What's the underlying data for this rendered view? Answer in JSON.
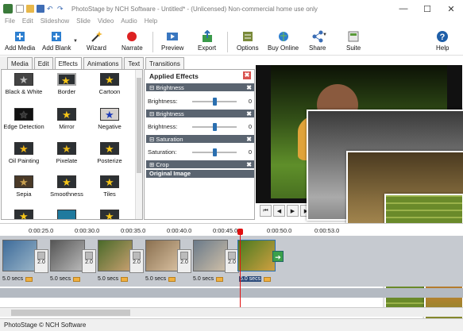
{
  "window": {
    "title": "PhotoStage by NCH Software - Untitled* - (Unlicensed) Non-commercial home use only",
    "minimize": "—",
    "maximize": "☐",
    "close": "✕"
  },
  "menu": [
    "File",
    "Edit",
    "Slideshow",
    "Slide",
    "Video",
    "Audio",
    "Help"
  ],
  "toolbar": {
    "add_media": "Add Media",
    "add_blank": "Add Blank",
    "wizard": "Wizard",
    "narrate": "Narrate",
    "preview": "Preview",
    "export": "Export",
    "options": "Options",
    "buy_online": "Buy Online",
    "share": "Share",
    "suite": "Suite",
    "help": "Help"
  },
  "tabs": [
    "Media",
    "Edit",
    "Effects",
    "Animations",
    "Text",
    "Transitions"
  ],
  "active_tab": "Effects",
  "effects": [
    "Black & White",
    "Border",
    "Cartoon",
    "Edge Detection",
    "Mirror",
    "Negative",
    "Oil Painting",
    "Pixelate",
    "Posterize",
    "Sepia",
    "Smoothness",
    "Tiles"
  ],
  "applied_effects": {
    "title": "Applied Effects",
    "close": "✖",
    "sections": [
      {
        "name": "Brightness",
        "prop": "Brightness:",
        "value": "0",
        "level": 0.5
      },
      {
        "name": "Brightness",
        "prop": "Brightness:",
        "value": "0",
        "level": 0.5
      },
      {
        "name": "Saturation",
        "prop": "Saturation:",
        "value": "0",
        "level": 0.5
      }
    ],
    "crop": "Crop",
    "original": "Original Image"
  },
  "timeline": {
    "ruler": [
      "0:00:25.0",
      "0:00:30.0",
      "0:00:35.0",
      "0:00:40.0",
      "0:00:45.0",
      "0:00:50.0",
      "0:00:53.0"
    ],
    "transition_value": "2.0",
    "durations": [
      "5.0 secs",
      "5.0 secs",
      "5.0 secs",
      "5.0 secs",
      "5.0 secs",
      "5.0 secs"
    ]
  },
  "status": "PhotoStage © NCH Software",
  "colors": {
    "accent": "#2a6fb0",
    "section": "#5a6470",
    "playhead": "#e01010",
    "star": "#f5c518"
  }
}
